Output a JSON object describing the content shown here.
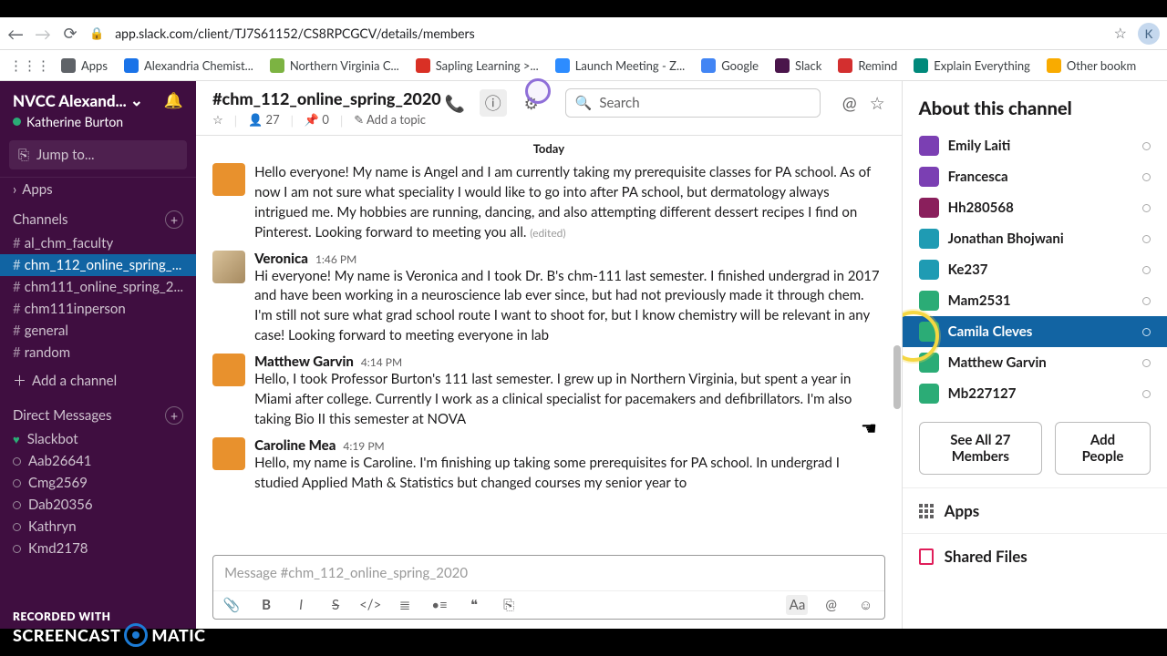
{
  "browser": {
    "url": "app.slack.com/client/TJ7S61152/CS8RPCGCV/details/members",
    "profile_initial": "K",
    "bookmarks": [
      {
        "label": "Apps",
        "color": "#5f6368"
      },
      {
        "label": "Alexandria Chemist...",
        "color": "#1a73e8"
      },
      {
        "label": "Northern Virginia C...",
        "color": "#7cb342"
      },
      {
        "label": "Sapling Learning >...",
        "color": "#d93025"
      },
      {
        "label": "Launch Meeting - Z...",
        "color": "#2d8cff"
      },
      {
        "label": "Google",
        "color": "#4285f4"
      },
      {
        "label": "Slack",
        "color": "#4a154b"
      },
      {
        "label": "Remind",
        "color": "#d32f2f"
      },
      {
        "label": "Explain Everything",
        "color": "#00897b"
      },
      {
        "label": "Other bookm",
        "color": "#f9ab00"
      }
    ]
  },
  "workspace": {
    "name": "NVCC Alexand...",
    "user": "Katherine Burton",
    "jump_label": "Jump to...",
    "drawer_apps": "Apps",
    "channels_label": "Channels",
    "channels": [
      {
        "name": "al_chm_faculty",
        "active": false
      },
      {
        "name": "chm_112_online_spring_...",
        "active": true
      },
      {
        "name": "chm111_online_spring_2...",
        "active": false
      },
      {
        "name": "chm111inperson",
        "active": false
      },
      {
        "name": "general",
        "active": false
      },
      {
        "name": "random",
        "active": false
      }
    ],
    "add_channel": "Add a channel",
    "dm_label": "Direct Messages",
    "dms": [
      {
        "name": "Slackbot",
        "kind": "heart"
      },
      {
        "name": "Aab26641",
        "kind": "away"
      },
      {
        "name": "Cmg2569",
        "kind": "away"
      },
      {
        "name": "Dab20356",
        "kind": "away"
      },
      {
        "name": "Kathryn",
        "kind": "away"
      },
      {
        "name": "Kmd2178",
        "kind": "away"
      }
    ]
  },
  "channel_header": {
    "title": "#chm_112_online_spring_2020",
    "members": "27",
    "pins": "0",
    "add_topic": "Add a topic",
    "search_placeholder": "Search"
  },
  "today_label": "Today",
  "messages": [
    {
      "author": "",
      "time": "",
      "avatar": "av-orange",
      "text": "Hello everyone! My name is Angel and I am currently taking my prerequisite classes for PA school. As of now I am not sure what speciality I would like to go into after PA school, but dermatology always intrigued me. My hobbies are running, dancing, and also attempting different dessert recipes I find on Pinterest.  Looking forward to meeting you all.",
      "edited": "(edited)"
    },
    {
      "author": "Veronica",
      "time": "1:46 PM",
      "avatar": "av-photo",
      "text": "Hi everyone! My name is Veronica and I took Dr. B's chm-111 last semester. I finished undergrad in 2017 and have been working in a neuroscience lab ever since, but had not previously made it through chem. I'm still not sure what grad school route I want to shoot for, but I know chemistry will be relevant in any case! Looking forward to meeting everyone in lab",
      "edited": ""
    },
    {
      "author": "Matthew Garvin",
      "time": "4:14 PM",
      "avatar": "av-orange",
      "text": "Hello, I took Professor Burton's 111 last semester. I grew up in Northern Virginia, but spent a year in Miami after college. Currently I work as a clinical specialist for pacemakers and defibrillators. I'm also taking Bio II this semester at NOVA",
      "edited": ""
    },
    {
      "author": "Caroline Mea",
      "time": "4:19 PM",
      "avatar": "av-orange2",
      "text": "Hello, my name is Caroline. I'm finishing up taking some prerequisites for PA school. In undergrad I studied Applied Math & Statistics but changed courses my senior year to",
      "edited": ""
    }
  ],
  "composer": {
    "placeholder": "Message #chm_112_online_spring_2020"
  },
  "about": {
    "title": "About this channel",
    "members": [
      {
        "name": "Emily Laiti",
        "color": "#7b3fb3",
        "selected": false
      },
      {
        "name": "Francesca",
        "color": "#7b3fb3",
        "selected": false
      },
      {
        "name": "Hh280568",
        "color": "#8a1f5c",
        "selected": false
      },
      {
        "name": "Jonathan Bhojwani",
        "color": "#1f9bb3",
        "selected": false
      },
      {
        "name": "Ke237",
        "color": "#1f9bb3",
        "selected": false
      },
      {
        "name": "Mam2531",
        "color": "#2bac76",
        "selected": false
      },
      {
        "name": "Camila Cleves",
        "color": "#2bac76",
        "selected": true
      },
      {
        "name": "Matthew Garvin",
        "color": "#2bac76",
        "selected": false
      },
      {
        "name": "Mb227127",
        "color": "#2bac76",
        "selected": false
      }
    ],
    "see_all": "See All 27 Members",
    "add_people": "Add People",
    "apps_label": "Apps",
    "files_label": "Shared Files"
  },
  "watermark": {
    "line1": "RECORDED WITH",
    "line2a": "SCREENCAST",
    "line2b": "MATIC"
  }
}
